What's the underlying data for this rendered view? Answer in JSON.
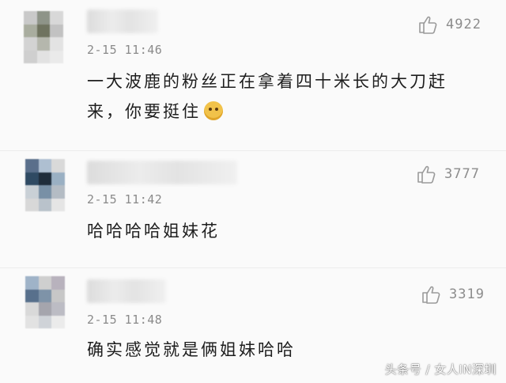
{
  "comments": [
    {
      "time": "2-15 11:46",
      "text": "一大波鹿的粉丝正在拿着四十米长的大刀赶来，你要挺住",
      "likes": "4922",
      "avatar_colors": [
        "#c9c9c9",
        "#8e9488",
        "#d8d8d8",
        "#a9ad9f",
        "#6f735f",
        "#c2c2c2",
        "#d3d3d3",
        "#b5b7ad",
        "#e3e3e3",
        "#cfcfcf",
        "#e2e2e2",
        "#eaeaea"
      ]
    },
    {
      "time": "2-15 11:42",
      "text": "哈哈哈哈姐妹花",
      "likes": "3777",
      "avatar_colors": [
        "#5a6f8b",
        "#aebfd1",
        "#d9d9d9",
        "#2f4a63",
        "#1f2d3b",
        "#9ab0c3",
        "#c9d0d6",
        "#7890a6",
        "#b4bcc4",
        "#d8d8d8",
        "#b9c2cb",
        "#e5e5e5"
      ]
    },
    {
      "time": "2-15 11:48",
      "text": "确实感觉就是俩姐妹哈哈",
      "likes": "3319",
      "avatar_colors": [
        "#9fb3c8",
        "#cfcfcf",
        "#b8b2bd",
        "#58708c",
        "#7e93a8",
        "#c7c7c7",
        "#d9d9d9",
        "#a5a5ad",
        "#bcbcc4",
        "#e2e2e2",
        "#cfd3d8",
        "#ebebeb"
      ]
    }
  ],
  "watermark": "头条号 / 女人IN深圳",
  "colors": {
    "background": "#fafafa",
    "timestamp": "#8a8a8a",
    "like_icon": "#9a9a9a"
  },
  "icons": {
    "like": "thumbs-up-icon"
  }
}
